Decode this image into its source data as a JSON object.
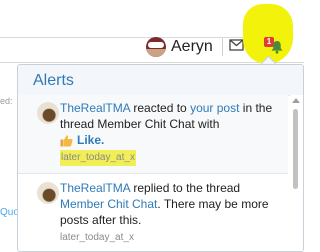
{
  "nav": {
    "user_name": "Aeryn",
    "alert_count": "1"
  },
  "background": {
    "fragment_1": "ed:",
    "fragment_2": "Quo"
  },
  "alerts_panel": {
    "title": "Alerts",
    "items": [
      {
        "user": "TheRealTMA",
        "text_1": " reacted to ",
        "link_1": "your post",
        "text_2": " in the thread Member Chit Chat with",
        "reaction": "Like.",
        "time": "later_today_at_x"
      },
      {
        "user": "TheRealTMA",
        "text_1": " replied to the thread ",
        "link_1": "Member Chit Chat",
        "text_2": ". There may be more posts after this.",
        "time": "later_today_at_x"
      }
    ]
  },
  "colors": {
    "accent": "#2f7ab8",
    "highlight": "#f3f20a",
    "badge": "#e03c31"
  }
}
